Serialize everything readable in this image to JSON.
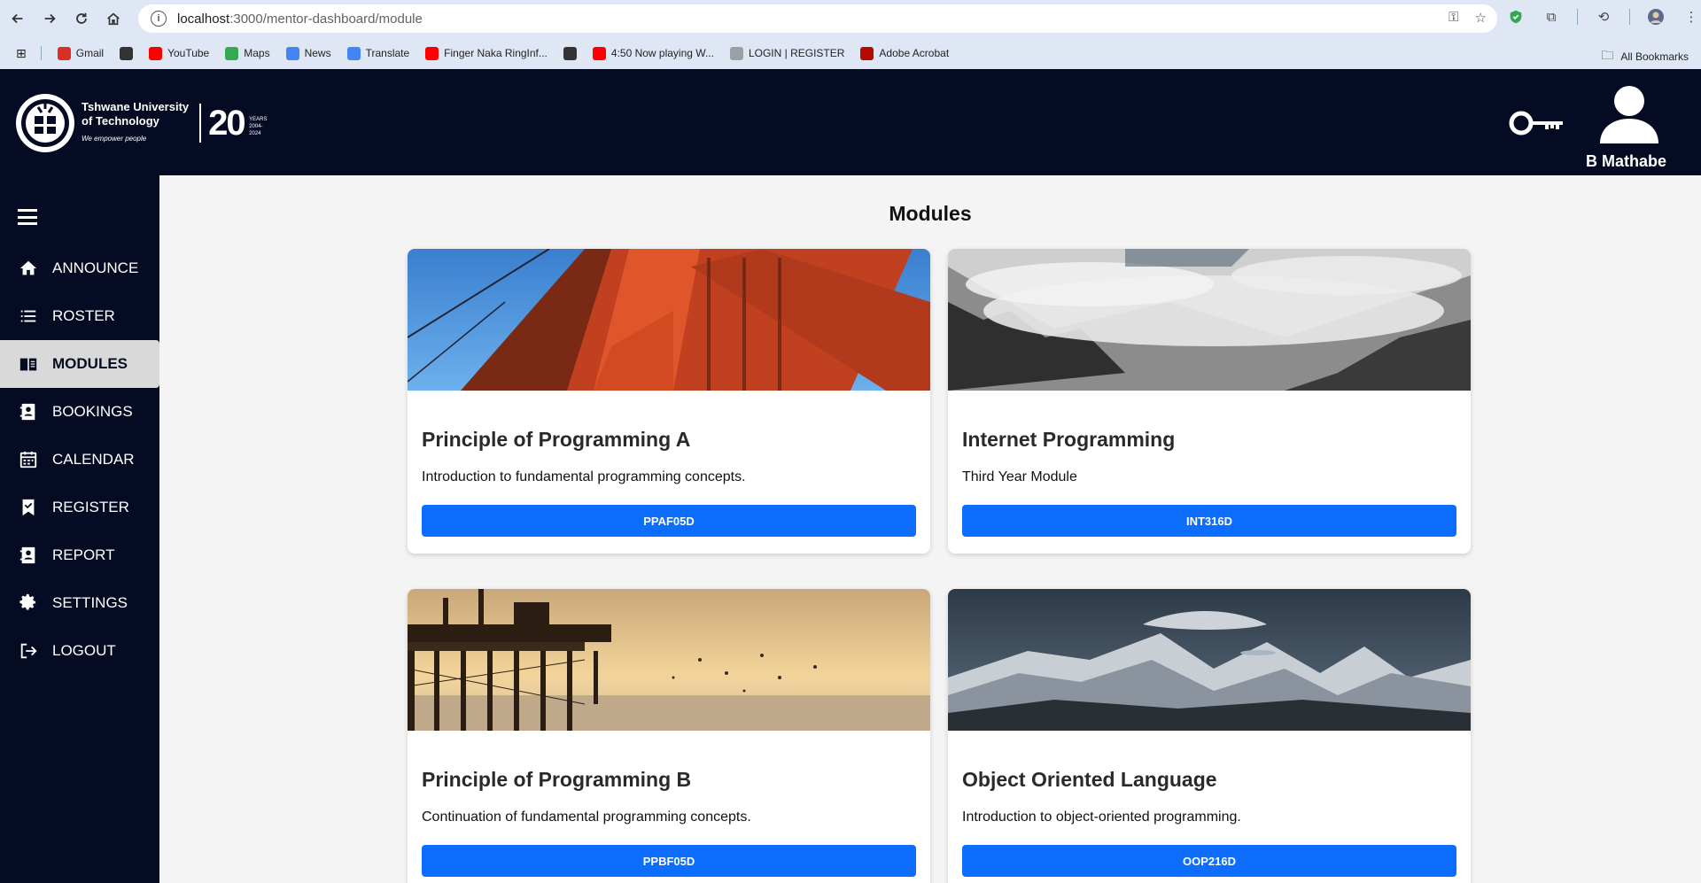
{
  "browser": {
    "url_host": "localhost",
    "url_path": ":3000/mentor-dashboard/module",
    "bookmarks": [
      {
        "label": "Gmail",
        "icon": "gmail-icon",
        "color": "#d93025"
      },
      {
        "label": "",
        "icon": "globe-icon",
        "color": "#333333"
      },
      {
        "label": "YouTube",
        "icon": "youtube-icon",
        "color": "#ff0000"
      },
      {
        "label": "Maps",
        "icon": "maps-icon",
        "color": "#34a853"
      },
      {
        "label": "News",
        "icon": "news-icon",
        "color": "#4285f4"
      },
      {
        "label": "Translate",
        "icon": "translate-icon",
        "color": "#4285f4"
      },
      {
        "label": "Finger Naka RingInf...",
        "icon": "youtube-icon",
        "color": "#ff0000"
      },
      {
        "label": "",
        "icon": "globe-icon",
        "color": "#333333"
      },
      {
        "label": "4:50 Now playing W...",
        "icon": "youtube-icon",
        "color": "#ff0000"
      },
      {
        "label": "LOGIN | REGISTER",
        "icon": "page-icon",
        "color": "#9aa0a6"
      },
      {
        "label": "Adobe Acrobat",
        "icon": "acrobat-icon",
        "color": "#b30b00"
      }
    ],
    "all_bookmarks": "All Bookmarks"
  },
  "header": {
    "logo": {
      "line1": "Tshwane University",
      "line2": "of Technology",
      "tagline": "We empower people",
      "anniversary": "20",
      "years": "YEARS",
      "range": "2004-2024"
    },
    "user_name": "B Mathabe"
  },
  "sidebar": {
    "items": [
      {
        "label": "ANNOUNCE",
        "icon": "home-icon",
        "active": false
      },
      {
        "label": "ROSTER",
        "icon": "list-icon",
        "active": false
      },
      {
        "label": "MODULES",
        "icon": "book-icon",
        "active": true
      },
      {
        "label": "BOOKINGS",
        "icon": "contact-book-icon",
        "active": false
      },
      {
        "label": "CALENDAR",
        "icon": "calendar-icon",
        "active": false
      },
      {
        "label": "REGISTER",
        "icon": "bookmark-check-icon",
        "active": false
      },
      {
        "label": "REPORT",
        "icon": "report-icon",
        "active": false
      },
      {
        "label": "SETTINGS",
        "icon": "gear-icon",
        "active": false
      },
      {
        "label": "LOGOUT",
        "icon": "logout-icon",
        "active": false
      }
    ]
  },
  "main": {
    "title": "Modules",
    "modules": [
      {
        "title": "Principle of Programming A",
        "description": "Introduction to fundamental programming concepts.",
        "code": "PPAF05D",
        "image": "bridge-image"
      },
      {
        "title": "Internet Programming",
        "description": "Third Year Module",
        "code": "INT316D",
        "image": "misty-mountains-image"
      },
      {
        "title": "Principle of Programming B",
        "description": "Continuation of fundamental programming concepts.",
        "code": "PPBF05D",
        "image": "pier-sunset-image"
      },
      {
        "title": "Object Oriented Language",
        "description": "Introduction to object-oriented programming.",
        "code": "OOP216D",
        "image": "snowy-peaks-image"
      }
    ]
  },
  "colors": {
    "navy": "#050b22",
    "primary_button": "#0d6efd",
    "active_menu": "#d9d9d9"
  }
}
